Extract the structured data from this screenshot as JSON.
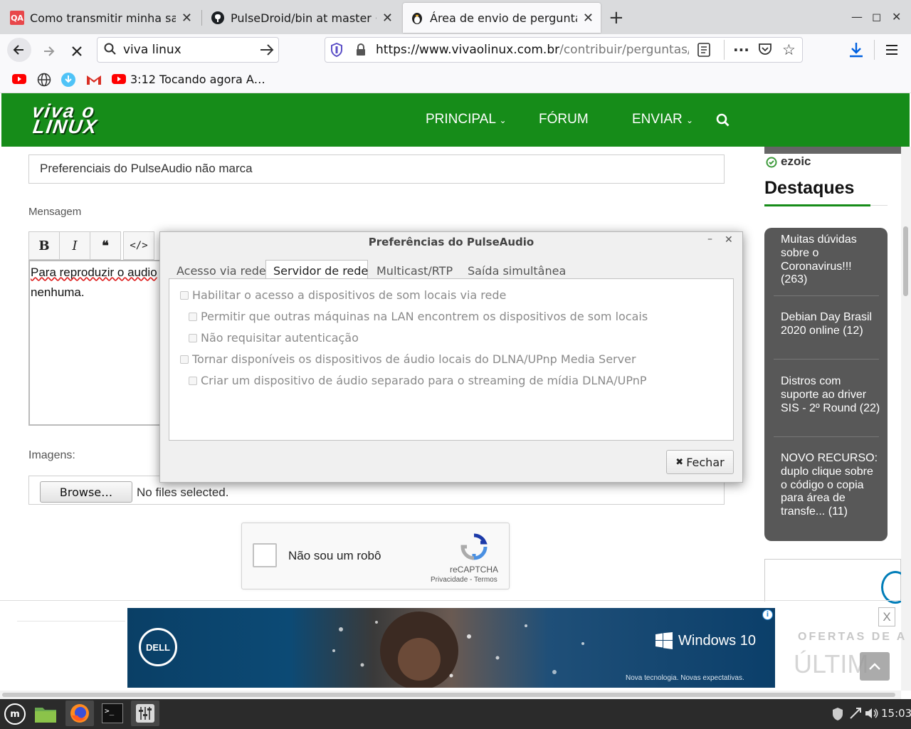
{
  "browser": {
    "tabs": [
      {
        "title": "Como transmitir minha saíd",
        "icon": "qa-icon",
        "badge": "QA"
      },
      {
        "title": "PulseDroid/bin at master · c",
        "icon": "github-icon"
      },
      {
        "title": "Área de envio de perguntas",
        "icon": "tux-icon"
      }
    ],
    "search_value": "viva linux",
    "url": "https://www.vivaolinux.com.br/contribuir/perguntas/in",
    "url_domain": "https://www.vivaolinux.com.br",
    "url_path": "/contribuir/perguntas/in",
    "bookmark_playing": "3:12 Tocando agora A…"
  },
  "site": {
    "logo_top": "viva o",
    "logo_bottom": "LINUX",
    "nav": [
      {
        "label": "PRINCIPAL",
        "has_dropdown": true
      },
      {
        "label": "FÓRUM",
        "has_dropdown": false
      },
      {
        "label": "ENVIAR",
        "has_dropdown": true
      }
    ]
  },
  "form": {
    "title_value": "Preferenciais do PulseAudio não marca",
    "message_label": "Mensagem",
    "toolbar": [
      "B",
      "I",
      "❝",
      "</>"
    ],
    "message_line1": "Para reproduzir o audio",
    "message_line2": "nenhuma.",
    "images_label": "Imagens:",
    "browse_label": "Browse…",
    "no_files": "No files selected.",
    "captcha_text": "Não sou um robô",
    "captcha_brand": "reCAPTCHA",
    "captcha_links": "Privacidade - Termos"
  },
  "sidebar": {
    "ezoic": "ezoic",
    "heading": "Destaques",
    "items": [
      {
        "text": "Muitas dúvidas sobre o Coronavirus!!! (263)"
      },
      {
        "text": "Debian Day Brasil 2020 online (12)"
      },
      {
        "text": "Distros com suporte ao driver SIS - 2º Round (22)"
      },
      {
        "text": "NOVO RECURSO: duplo clique sobre o código o copia para área de transfe... (11)"
      }
    ]
  },
  "dialog": {
    "title": "Preferências do PulseAudio",
    "tabs": [
      "Acesso via rede",
      "Servidor de rede",
      "Multicast/RTP",
      "Saída simultânea"
    ],
    "active_tab": "Servidor de rede",
    "options": [
      {
        "label": "Habilitar o acesso a dispositivos de som locais via rede",
        "checked": false,
        "indent": 0
      },
      {
        "label": "Permitir que outras máquinas na LAN encontrem os dispositivos de som locais",
        "checked": false,
        "indent": 1
      },
      {
        "label": "Não requisitar autenticação",
        "checked": false,
        "indent": 1
      },
      {
        "label": "Tornar disponíveis os dispositivos de áudio locais do DLNA/UPnp Media Server",
        "checked": false,
        "indent": 0
      },
      {
        "label": "Criar um dispositivo de áudio separado para o streaming de mídia DLNA/UPnP",
        "checked": false,
        "indent": 1
      }
    ],
    "close_button": "Fechar"
  },
  "ad": {
    "brand": "DELL",
    "product": "Windows 10",
    "tagline": "Nova tecnologia. Novas expectativas.",
    "close": "X",
    "side_text1": "OFERTAS DE A",
    "side_text2": "ÚLTIM"
  },
  "taskbar": {
    "clock": "15:03"
  },
  "colors": {
    "site_green": "#168c19",
    "sidebar_gray": "#585858",
    "firefox_blue": "#0060df"
  }
}
